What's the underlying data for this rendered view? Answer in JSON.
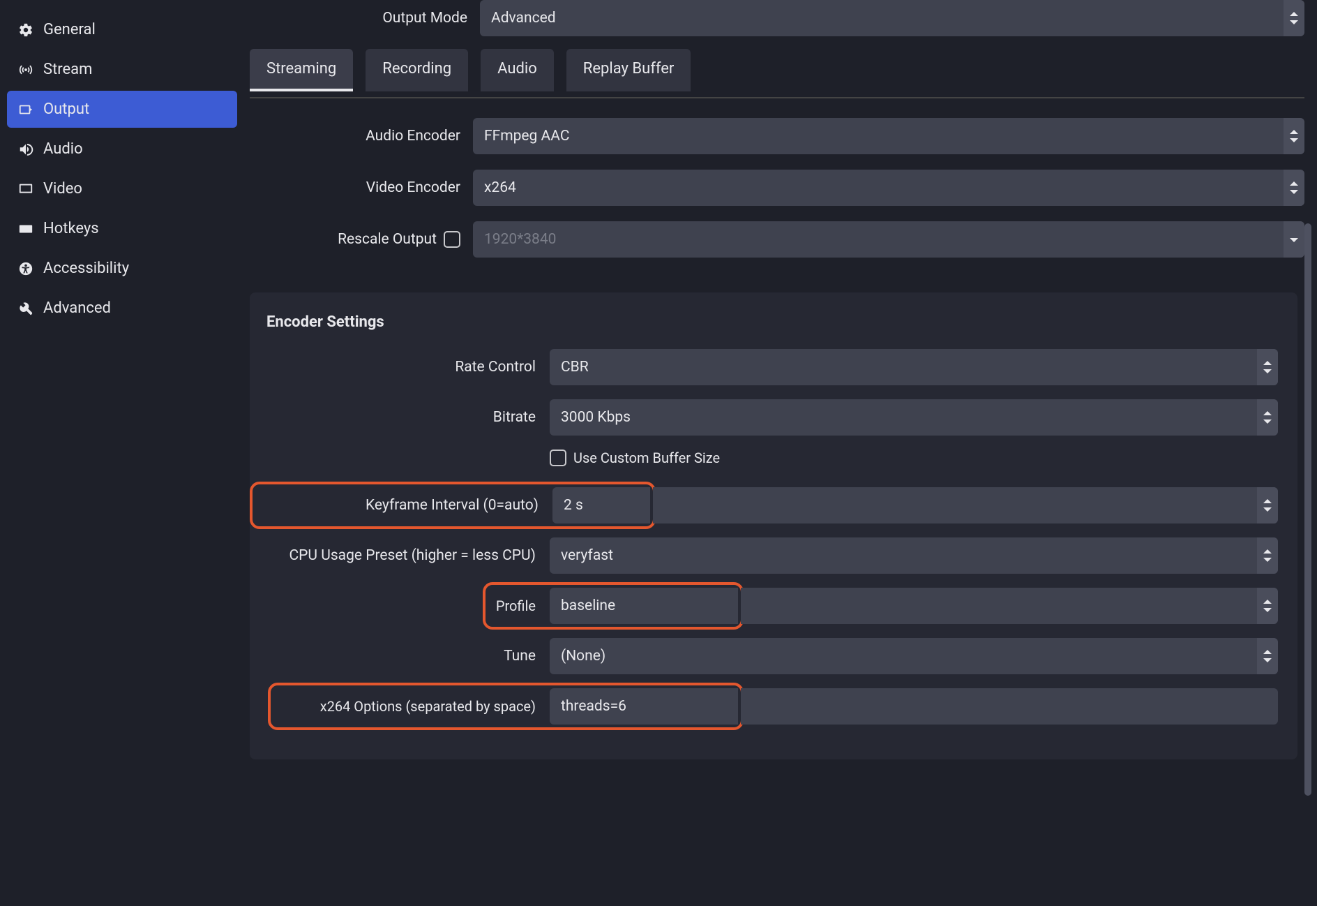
{
  "sidebar": {
    "items": [
      {
        "label": "General",
        "icon": "gear"
      },
      {
        "label": "Stream",
        "icon": "antenna"
      },
      {
        "label": "Output",
        "icon": "output"
      },
      {
        "label": "Audio",
        "icon": "speaker"
      },
      {
        "label": "Video",
        "icon": "monitor"
      },
      {
        "label": "Hotkeys",
        "icon": "keyboard"
      },
      {
        "label": "Accessibility",
        "icon": "accessibility"
      },
      {
        "label": "Advanced",
        "icon": "tools"
      }
    ],
    "active_index": 2
  },
  "output_mode": {
    "label": "Output Mode",
    "value": "Advanced"
  },
  "tabs": [
    "Streaming",
    "Recording",
    "Audio",
    "Replay Buffer"
  ],
  "active_tab": 0,
  "upper": {
    "audio_encoder": {
      "label": "Audio Encoder",
      "value": "FFmpeg AAC"
    },
    "video_encoder": {
      "label": "Video Encoder",
      "value": "x264"
    },
    "rescale_output": {
      "label": "Rescale Output",
      "checked": false,
      "placeholder": "1920*3840"
    }
  },
  "encoder": {
    "title": "Encoder Settings",
    "rate_control": {
      "label": "Rate Control",
      "value": "CBR"
    },
    "bitrate": {
      "label": "Bitrate",
      "value": "3000 Kbps"
    },
    "custom_buffer": {
      "label": "Use Custom Buffer Size",
      "checked": false
    },
    "keyframe": {
      "label": "Keyframe Interval (0=auto)",
      "value": "2 s"
    },
    "cpu_preset": {
      "label": "CPU Usage Preset (higher = less CPU)",
      "value": "veryfast"
    },
    "profile": {
      "label": "Profile",
      "value": "baseline"
    },
    "tune": {
      "label": "Tune",
      "value": "(None)"
    },
    "x264_options": {
      "label": "x264 Options (separated by space)",
      "value": "threads=6"
    }
  }
}
